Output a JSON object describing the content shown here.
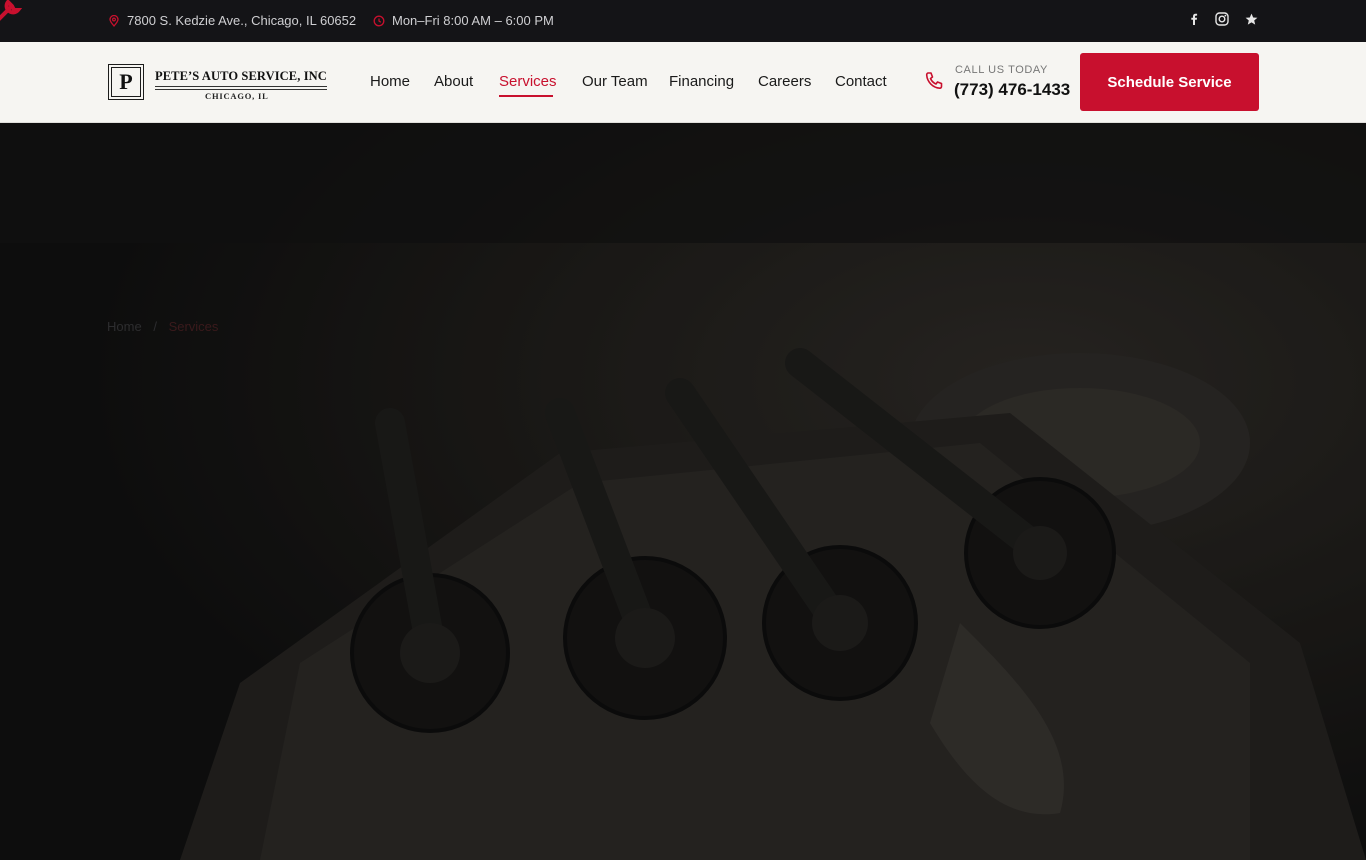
{
  "topbar": {
    "address": "7800 S. Kedzie Ave., Chicago, IL 60652",
    "hours": "Mon–Fri 8:00 AM – 6:00 PM",
    "accent": "#c8102e",
    "icons": [
      "wrench-icon",
      "map-pin-icon",
      "clock-icon",
      "facebook-icon",
      "instagram-icon",
      "star-icon"
    ]
  },
  "logo": {
    "letter": "P",
    "name": "PETE’S AUTO SERVICE, INC",
    "city": "CHICAGO, IL"
  },
  "nav": {
    "items": [
      "Home",
      "About",
      "Services",
      "Our Team",
      "Financing",
      "Careers",
      "Contact"
    ],
    "active": "Services"
  },
  "contact": {
    "label": "CALL US TODAY",
    "phone": "(773) 476-1433"
  },
  "cta": {
    "label": "Schedule Service",
    "color": "#c8102e"
  },
  "breadcrumb": {
    "home": "Home",
    "separator": "/",
    "current": "Services"
  }
}
